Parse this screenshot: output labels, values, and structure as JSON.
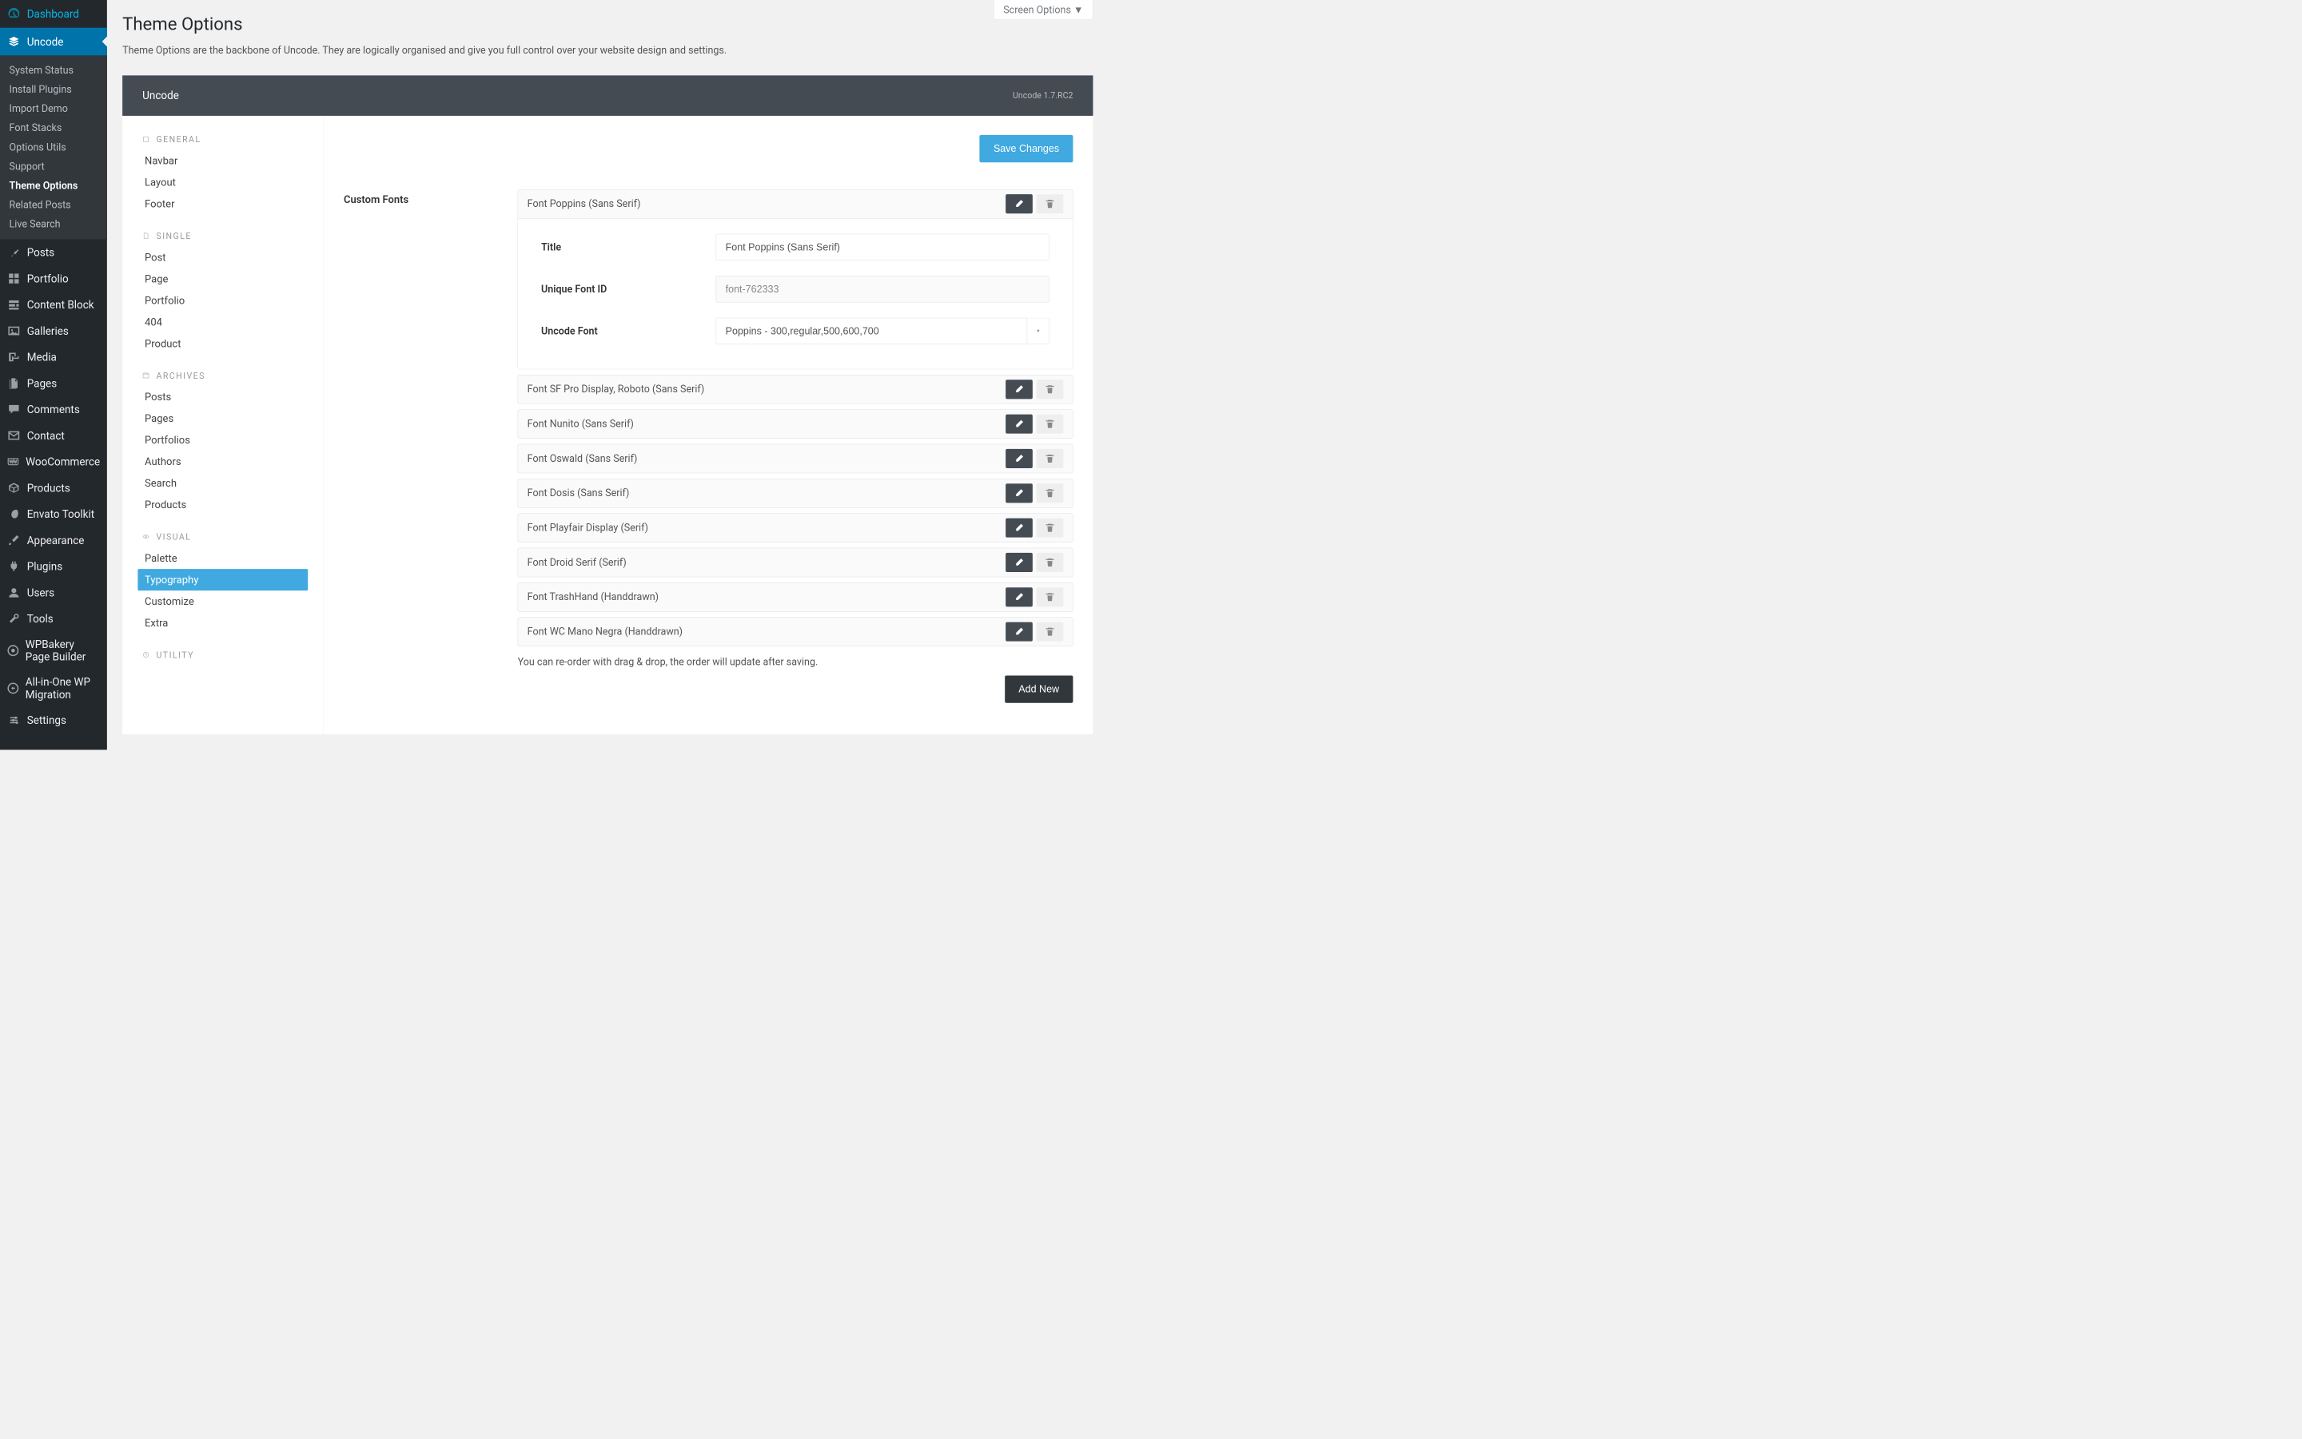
{
  "screen_options": "Screen Options ▼",
  "page_title": "Theme Options",
  "page_desc": "Theme Options are the backbone of Uncode. They are logically organised and give you full control over your website design and settings.",
  "panel_title": "Uncode",
  "panel_version": "Uncode 1.7.RC2",
  "save_button": "Save Changes",
  "add_new": "Add New",
  "reorder_note": "You can re-order with drag & drop, the order will update after saving.",
  "custom_fonts_label": "Custom Fonts",
  "expanded": {
    "title_label": "Title",
    "id_label": "Unique Font ID",
    "font_label": "Uncode Font",
    "title_value": "Font Poppins (Sans Serif)",
    "id_value": "font-762333",
    "font_value": "Poppins - 300,regular,500,600,700"
  },
  "fonts": [
    "Font Poppins (Sans Serif)",
    "Font SF Pro Display, Roboto (Sans Serif)",
    "Font Nunito (Sans Serif)",
    "Font Oswald (Sans Serif)",
    "Font Dosis (Sans Serif)",
    "Font Playfair Display (Serif)",
    "Font Droid Serif (Serif)",
    "Font TrashHand (Handdrawn)",
    "Font WC Mano Negra (Handdrawn)"
  ],
  "main_menu": [
    {
      "label": "Dashboard",
      "icon": "dashboard"
    },
    {
      "label": "Uncode",
      "icon": "layers",
      "active": true
    },
    {
      "label": "Posts",
      "icon": "pin"
    },
    {
      "label": "Portfolio",
      "icon": "grid"
    },
    {
      "label": "Content Block",
      "icon": "blocks"
    },
    {
      "label": "Galleries",
      "icon": "gallery"
    },
    {
      "label": "Media",
      "icon": "media"
    },
    {
      "label": "Pages",
      "icon": "pages"
    },
    {
      "label": "Comments",
      "icon": "comments"
    },
    {
      "label": "Contact",
      "icon": "mail"
    },
    {
      "label": "WooCommerce",
      "icon": "woo"
    },
    {
      "label": "Products",
      "icon": "box"
    },
    {
      "label": "Envato Toolkit",
      "icon": "envato"
    },
    {
      "label": "Appearance",
      "icon": "brush"
    },
    {
      "label": "Plugins",
      "icon": "plug"
    },
    {
      "label": "Users",
      "icon": "user"
    },
    {
      "label": "Tools",
      "icon": "wrench"
    },
    {
      "label": "WPBakery Page Builder",
      "icon": "wpb"
    },
    {
      "label": "All-in-One WP Migration",
      "icon": "migrate"
    },
    {
      "label": "Settings",
      "icon": "settings"
    }
  ],
  "submenu": [
    {
      "label": "System Status"
    },
    {
      "label": "Install Plugins"
    },
    {
      "label": "Import Demo"
    },
    {
      "label": "Font Stacks"
    },
    {
      "label": "Options Utils"
    },
    {
      "label": "Support"
    },
    {
      "label": "Theme Options",
      "current": true
    },
    {
      "label": "Related Posts"
    },
    {
      "label": "Live Search"
    }
  ],
  "panel_nav": [
    {
      "header": "GENERAL",
      "items": [
        "Navbar",
        "Layout",
        "Footer"
      ]
    },
    {
      "header": "SINGLE",
      "items": [
        "Post",
        "Page",
        "Portfolio",
        "404",
        "Product"
      ]
    },
    {
      "header": "ARCHIVES",
      "items": [
        "Posts",
        "Pages",
        "Portfolios",
        "Authors",
        "Search",
        "Products"
      ]
    },
    {
      "header": "VISUAL",
      "items": [
        "Palette",
        "Typography",
        "Customize",
        "Extra"
      ],
      "active": "Typography"
    },
    {
      "header": "UTILITY",
      "items": []
    }
  ]
}
